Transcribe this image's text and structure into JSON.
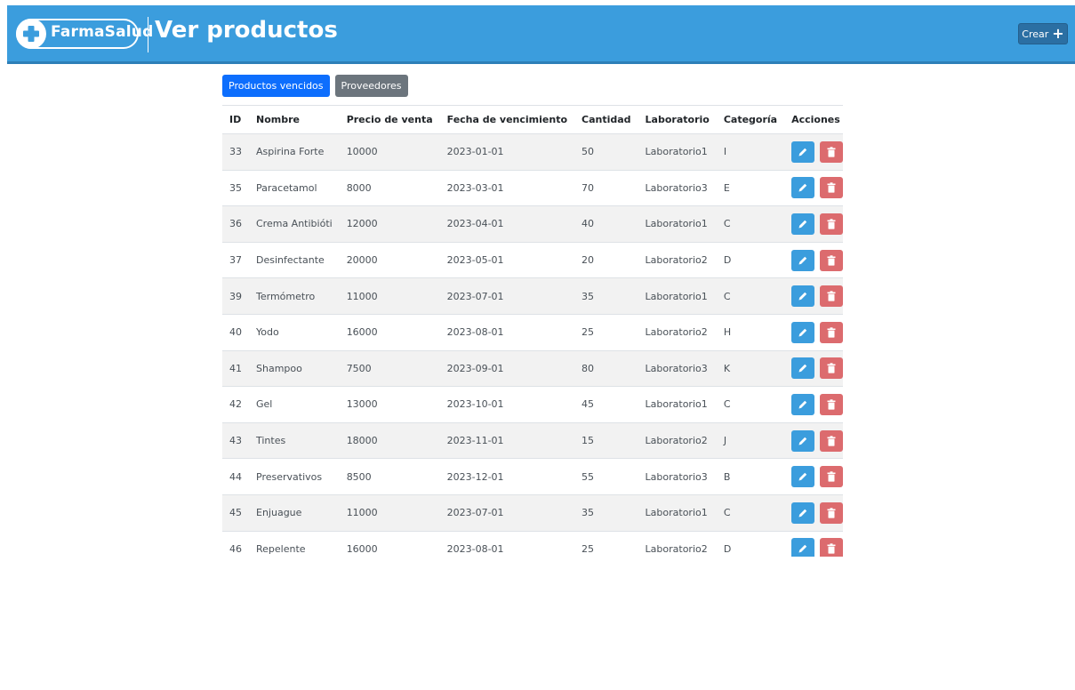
{
  "header": {
    "logo_text": "FarmaSalud",
    "title": "Ver productos",
    "create_label": "Crear"
  },
  "tabs": [
    {
      "label": "Productos vencidos",
      "active": true
    },
    {
      "label": "Proveedores",
      "active": false
    }
  ],
  "table": {
    "columns": [
      "ID",
      "Nombre",
      "Precio de venta",
      "Fecha de vencimiento",
      "Cantidad",
      "Laboratorio",
      "Categoría",
      "Acciones"
    ],
    "rows": [
      [
        "33",
        "Aspirina Forte",
        "10000",
        "2023-01-01",
        "50",
        "Laboratorio1",
        "I"
      ],
      [
        "35",
        "Paracetamol",
        "8000",
        "2023-03-01",
        "70",
        "Laboratorio3",
        "E"
      ],
      [
        "36",
        "Crema Antibióti",
        "12000",
        "2023-04-01",
        "40",
        "Laboratorio1",
        "C"
      ],
      [
        "37",
        "Desinfectante",
        "20000",
        "2023-05-01",
        "20",
        "Laboratorio2",
        "D"
      ],
      [
        "39",
        "Termómetro",
        "11000",
        "2023-07-01",
        "35",
        "Laboratorio1",
        "C"
      ],
      [
        "40",
        "Yodo",
        "16000",
        "2023-08-01",
        "25",
        "Laboratorio2",
        "H"
      ],
      [
        "41",
        "Shampoo",
        "7500",
        "2023-09-01",
        "80",
        "Laboratorio3",
        "K"
      ],
      [
        "42",
        "Gel",
        "13000",
        "2023-10-01",
        "45",
        "Laboratorio1",
        "C"
      ],
      [
        "43",
        "Tintes",
        "18000",
        "2023-11-01",
        "15",
        "Laboratorio2",
        "J"
      ],
      [
        "44",
        "Preservativos",
        "8500",
        "2023-12-01",
        "55",
        "Laboratorio3",
        "B"
      ],
      [
        "45",
        "Enjuague",
        "11000",
        "2023-07-01",
        "35",
        "Laboratorio1",
        "C"
      ],
      [
        "46",
        "Repelente",
        "16000",
        "2023-08-01",
        "25",
        "Laboratorio2",
        "D"
      ]
    ]
  },
  "icons": {
    "logo": "cross-icon",
    "create": "plus-icon",
    "edit": "pencil-icon",
    "delete": "trash-icon"
  },
  "colors": {
    "header": "#3b9ddd",
    "primary_tab": "#0d6efd",
    "secondary_tab": "#6c757d",
    "edit": "#3b9ddd",
    "delete": "#dc6b6e"
  }
}
